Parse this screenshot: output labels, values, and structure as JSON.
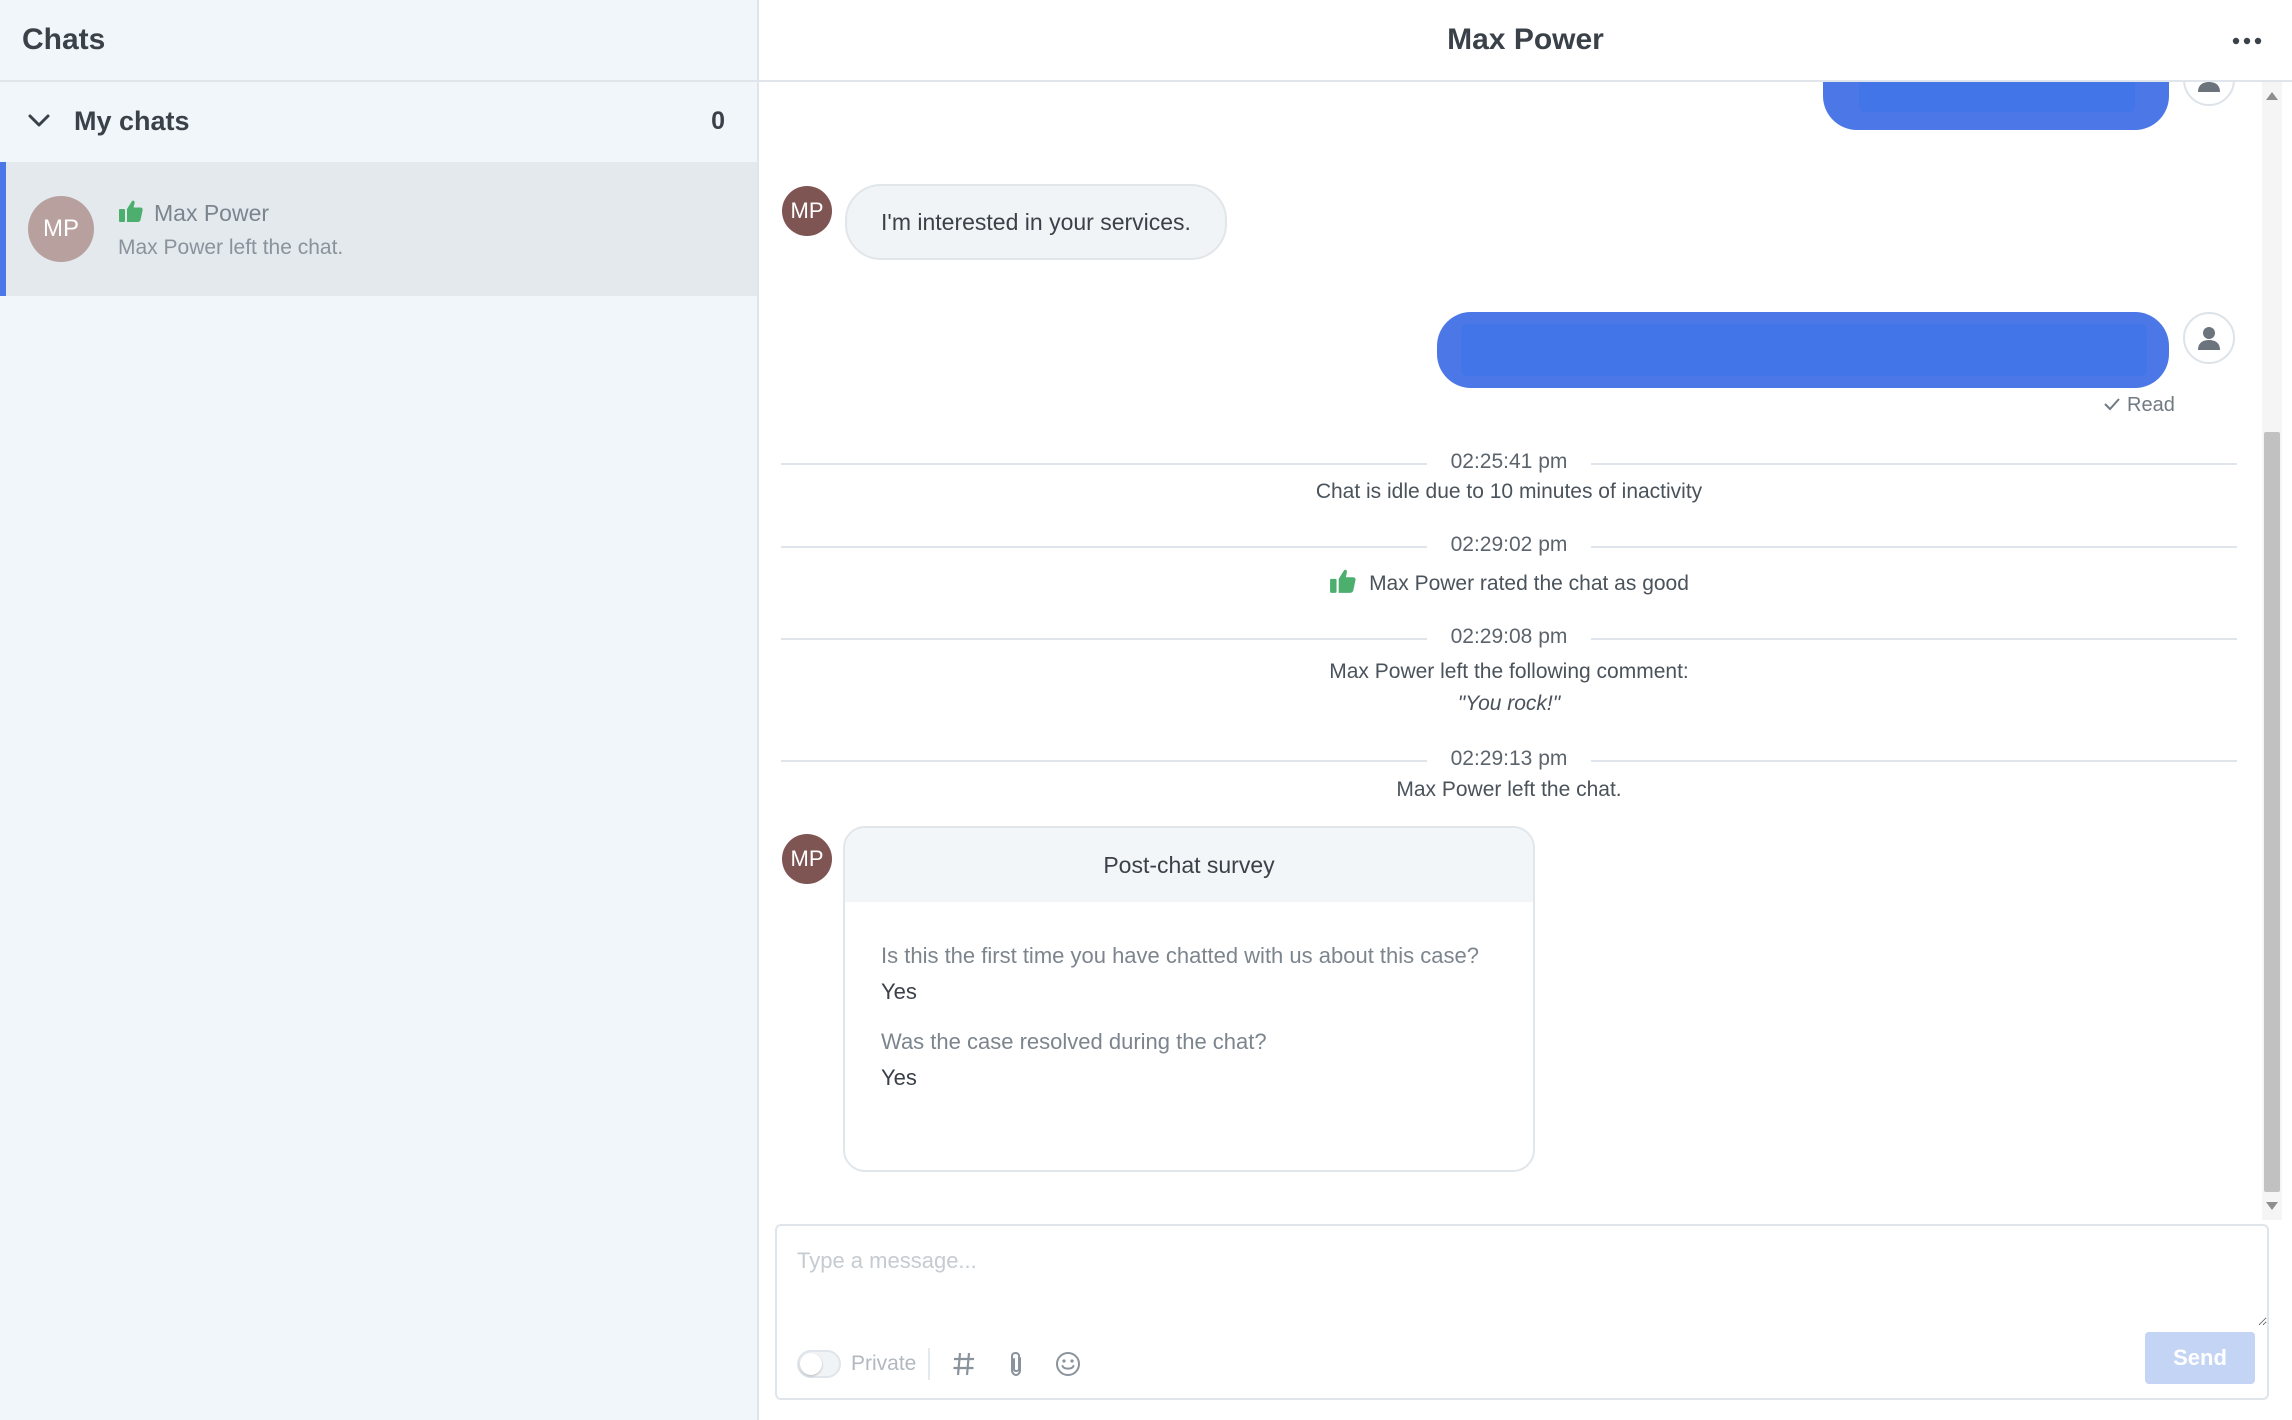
{
  "sidebar": {
    "title": "Chats",
    "section": {
      "label": "My chats",
      "count": "0"
    },
    "chat_item": {
      "avatar_initials": "MP",
      "name": "Max Power",
      "preview": "Max Power left the chat.",
      "rating_icon": "thumbs-up-icon"
    }
  },
  "main": {
    "title": "Max Power",
    "messages": {
      "incoming_1": {
        "avatar_initials": "MP",
        "text": "I'm interested in your services."
      },
      "read_receipt": "Read",
      "events": [
        {
          "time": "02:25:41 pm",
          "text": "Chat is idle due to 10 minutes of inactivity"
        },
        {
          "time": "02:29:02 pm",
          "text": "Max Power rated the chat as good"
        },
        {
          "time": "02:29:08 pm",
          "text": "Max Power left the following comment:",
          "quote": "\"You rock!\""
        },
        {
          "time": "02:29:13 pm",
          "text": "Max Power left the chat."
        }
      ],
      "survey": {
        "avatar_initials": "MP",
        "title": "Post-chat survey",
        "questions": [
          {
            "q": "Is this the first time you have chatted with us about this case?",
            "a": "Yes"
          },
          {
            "q": "Was the case resolved during the chat?",
            "a": "Yes"
          }
        ]
      }
    },
    "composer": {
      "placeholder": "Type a message...",
      "private_label": "Private",
      "send_label": "Send"
    }
  },
  "colors": {
    "accent": "#4b78e6",
    "rating_green": "#4caf6e",
    "sidebar_bg": "#f1f6fa"
  }
}
